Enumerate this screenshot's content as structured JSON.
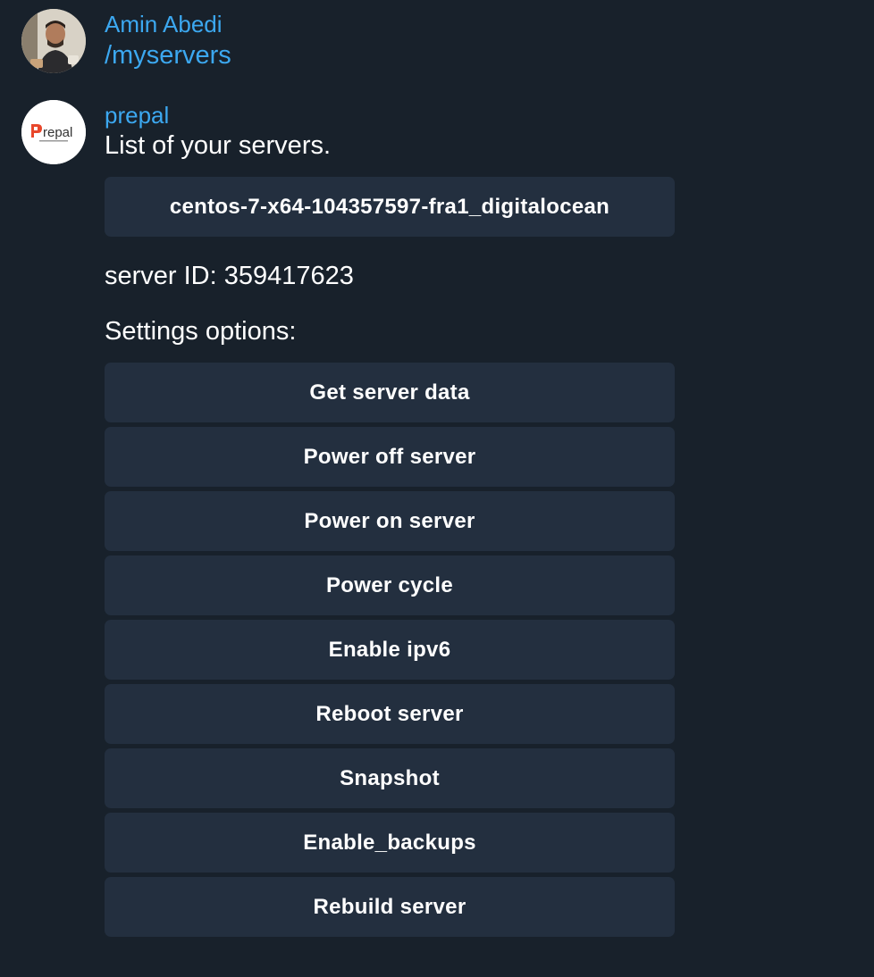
{
  "messages": {
    "user": {
      "sender": "Amin Abedi",
      "text": "/myservers"
    },
    "bot": {
      "sender": "prepal",
      "logo_text": "Prepal",
      "text": "List of your servers.",
      "server_button": "centos-7-x64-104357597-fra1_digitalocean",
      "server_id_text": "server ID: 359417623",
      "settings_heading": "Settings options:",
      "options": [
        "Get server data",
        "Power off server",
        "Power on server",
        "Power cycle",
        "Enable ipv6",
        "Reboot server",
        "Snapshot",
        "Enable_backups",
        "Rebuild server"
      ]
    }
  },
  "colors": {
    "background": "#18212b",
    "accent": "#3ca8f0",
    "button": "#232f3f",
    "logo_accent": "#e8472b"
  }
}
